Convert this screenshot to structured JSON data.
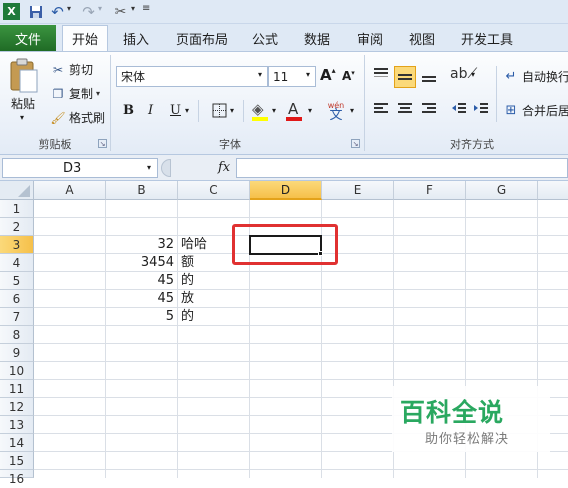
{
  "colors": {
    "accent_file_tab": "#2e7d32",
    "selection": "#f6c04a",
    "annotation": "#e03131",
    "watermark": "#2aa860"
  },
  "qat": {
    "icons": [
      "excel-icon",
      "save-icon",
      "undo-icon",
      "redo-icon",
      "tools-icon",
      "customize-icon"
    ]
  },
  "tabs": [
    "文件",
    "开始",
    "插入",
    "页面布局",
    "公式",
    "数据",
    "审阅",
    "视图",
    "开发工具"
  ],
  "clipboard": {
    "paste": "粘贴",
    "cut": "剪切",
    "copy": "复制",
    "format_painter": "格式刷",
    "group": "剪贴板"
  },
  "font": {
    "name": "宋体",
    "size": "11",
    "bold": "B",
    "italic": "I",
    "underline": "U",
    "group": "字体",
    "phonetic": "wén",
    "phonetic_char": "文"
  },
  "alignment": {
    "wrap": "自动换行",
    "merge": "合并后居",
    "group": "对齐方式"
  },
  "formula_bar": {
    "name_box": "D3",
    "fx": "fx",
    "value": ""
  },
  "columns": [
    "A",
    "B",
    "C",
    "D",
    "E",
    "F",
    "G"
  ],
  "rows": [
    "1",
    "2",
    "3",
    "4",
    "5",
    "6",
    "7",
    "8",
    "9",
    "10",
    "11",
    "12",
    "13",
    "14",
    "15",
    "16"
  ],
  "cells": {
    "B3": "32",
    "C3": "哈哈",
    "B4": "3454",
    "C4": "额",
    "B5": "45",
    "C5": "的",
    "B6": "45",
    "C6": "放",
    "B7": "5",
    "C7": "的"
  },
  "watermark": {
    "title": "百科全说",
    "subtitle": "助你轻松解决"
  }
}
